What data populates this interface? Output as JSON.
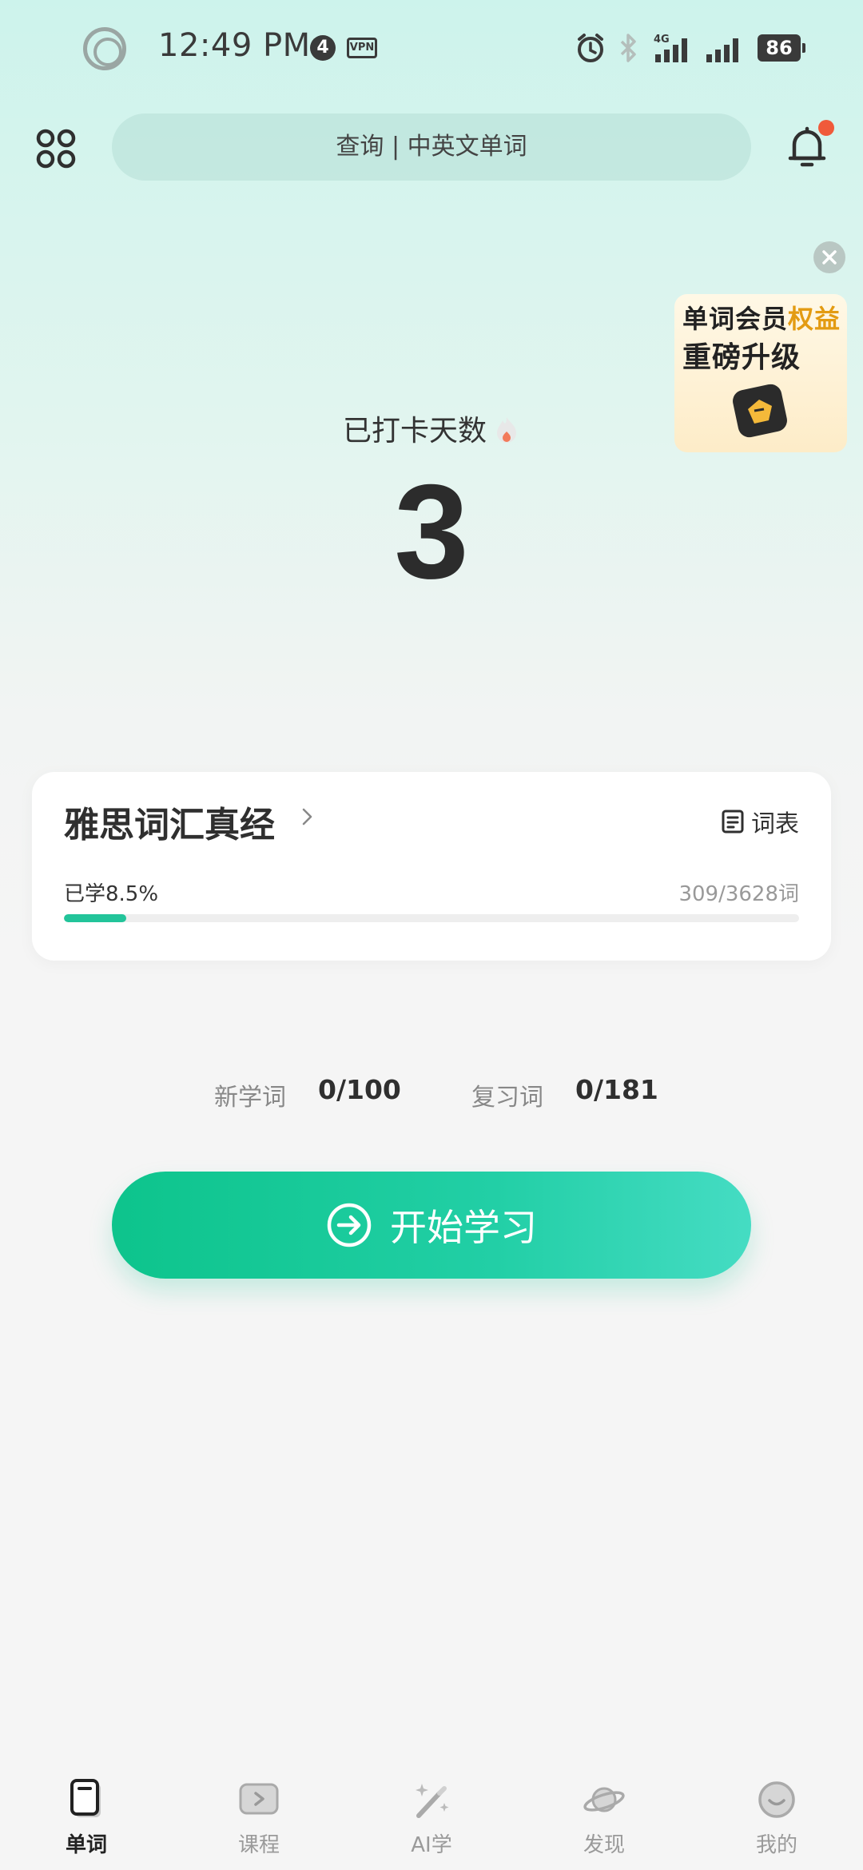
{
  "status_bar": {
    "time": "12:49 PM",
    "notification_count": "4",
    "vpn": "VPN",
    "battery": "86",
    "network": "4G"
  },
  "header": {
    "search_placeholder": "查询 | 中英文单词"
  },
  "promo": {
    "line1_a": "单词会员",
    "line1_b": "权益",
    "line2": "重磅升级"
  },
  "checkin": {
    "label": "已打卡天数",
    "days": "3"
  },
  "book": {
    "title": "雅思词汇真经",
    "wordlist_label": "词表",
    "progress_label": "已学8.5%",
    "progress_count": "309/3628词",
    "progress_fraction": 0.085
  },
  "stats": {
    "new_label": "新学词",
    "new_value": "0/100",
    "review_label": "复习词",
    "review_value": "0/181"
  },
  "start_button": {
    "label": "开始学习"
  },
  "bottom_nav": {
    "items": [
      {
        "label": "单词",
        "icon": "word-card-icon",
        "active": true
      },
      {
        "label": "课程",
        "icon": "play-box-icon",
        "active": false
      },
      {
        "label": "AI学",
        "icon": "magic-wand-icon",
        "active": false
      },
      {
        "label": "发现",
        "icon": "planet-icon",
        "active": false
      },
      {
        "label": "我的",
        "icon": "smiley-icon",
        "active": false
      }
    ]
  },
  "colors": {
    "accent": "#22c49a",
    "notification_dot": "#f05a3a"
  }
}
